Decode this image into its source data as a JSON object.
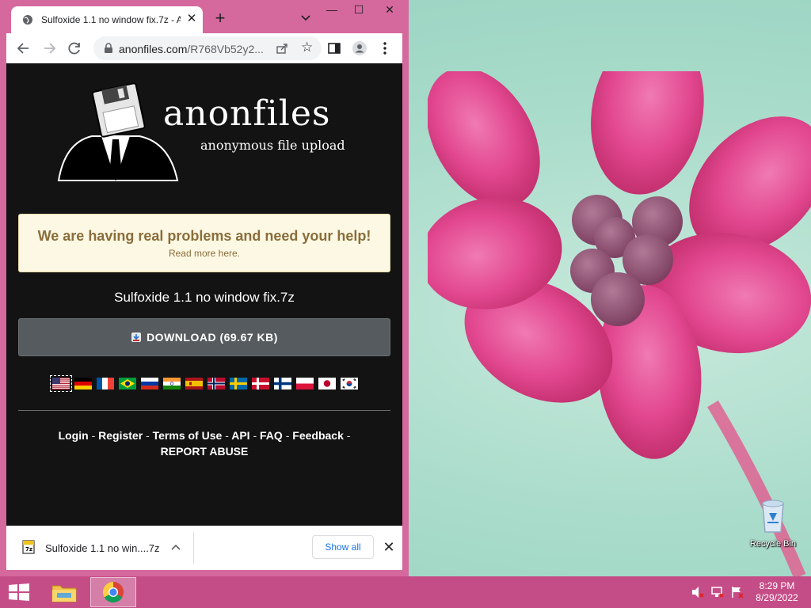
{
  "browser": {
    "tab_title": "Sulfoxide 1.1 no window fix.7z - A",
    "new_tab_label": "+",
    "url_host": "anonfiles.com",
    "url_path": "/R768Vb52y2...",
    "tab_close": "✕",
    "window_min": "—",
    "window_max": "☐",
    "window_close": "✕"
  },
  "page": {
    "logo_word": "anonfiles",
    "logo_tagline": "anonymous file upload",
    "notice_title": "We are having real problems and need your help!",
    "notice_sub": "Read more here.",
    "file_name": "Sulfoxide 1.1 no window fix.7z",
    "download_label": "DOWNLOAD (69.67 KB)",
    "flags": [
      "us",
      "de",
      "fr",
      "br",
      "ru",
      "in",
      "es",
      "no",
      "se",
      "dk",
      "fi",
      "pl",
      "jp",
      "kr"
    ],
    "selected_flag": "us",
    "footer": {
      "login": "Login",
      "register": "Register",
      "terms": "Terms of Use",
      "api": "API",
      "faq": "FAQ",
      "feedback": "Feedback",
      "report": "REPORT ABUSE",
      "separator": "-"
    }
  },
  "download_shelf": {
    "file_name": "Sulfoxide 1.1 no win....7z",
    "show_all": "Show all",
    "close": "✕"
  },
  "desktop": {
    "recycle_bin": "Recycle Bin"
  },
  "taskbar": {
    "time": "8:29 PM",
    "date": "8/29/2022"
  },
  "colors": {
    "window_frame": "#d5689c",
    "taskbar": "#c54d87",
    "page_bg": "#131313",
    "notice_bg": "#fcf8e3",
    "notice_text": "#8a6d3b",
    "download_bg": "#555b5e",
    "link_blue": "#1a73e8"
  },
  "icons": [
    "globe-icon",
    "back-arrow-icon",
    "forward-arrow-icon",
    "reload-icon",
    "lock-icon",
    "share-icon",
    "star-icon",
    "side-panel-icon",
    "profile-icon",
    "kebab-menu-icon",
    "chevron-down-icon",
    "windows-start-icon",
    "file-explorer-icon",
    "chrome-icon",
    "volume-muted-icon",
    "network-icon",
    "action-center-icon",
    "recycle-bin-icon",
    "7z-file-icon"
  ]
}
